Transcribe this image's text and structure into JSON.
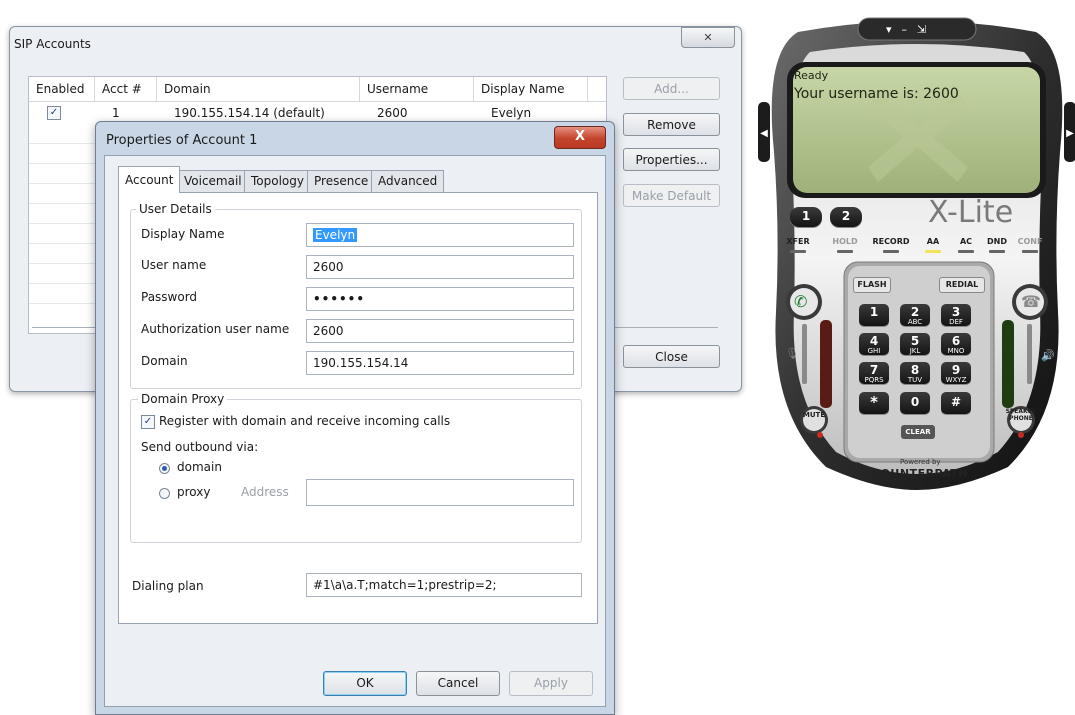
{
  "sip_window": {
    "title": "SIP Accounts",
    "close_glyph": "✕",
    "columns": [
      "Enabled",
      "Acct #",
      "Domain",
      "Username",
      "Display Name"
    ],
    "rows": [
      {
        "enabled": true,
        "acct": "1",
        "domain": "190.155.154.14 (default)",
        "username": "2600",
        "display_name": "Evelyn"
      }
    ],
    "buttons": {
      "add": "Add...",
      "remove": "Remove",
      "properties": "Properties...",
      "make_default": "Make Default",
      "close": "Close"
    }
  },
  "props_dialog": {
    "title": "Properties of Account 1",
    "close_glyph": "X",
    "tabs": [
      "Account",
      "Voicemail",
      "Topology",
      "Presence",
      "Advanced"
    ],
    "active_tab": "Account",
    "user_details": {
      "group_label": "User Details",
      "display_name_label": "Display Name",
      "display_name_value": "Evelyn",
      "user_name_label": "User name",
      "user_name_value": "2600",
      "password_label": "Password",
      "password_value": "••••••",
      "auth_user_label": "Authorization user name",
      "auth_user_value": "2600",
      "domain_label": "Domain",
      "domain_value": "190.155.154.14"
    },
    "domain_proxy": {
      "group_label": "Domain Proxy",
      "register_label": "Register with domain and receive incoming calls",
      "register_checked": true,
      "send_outbound_label": "Send outbound via:",
      "option_domain": "domain",
      "option_proxy": "proxy",
      "selected": "domain",
      "address_label": "Address",
      "address_value": ""
    },
    "dialing_plan_label": "Dialing plan",
    "dialing_plan_value": "#1\\a\\a.T;match=1;prestrip=2;",
    "buttons": {
      "ok": "OK",
      "cancel": "Cancel",
      "apply": "Apply"
    }
  },
  "phone": {
    "status_line": "Ready",
    "message": "Your username is: 2600",
    "brand": "X-Lite",
    "line_buttons": [
      "1",
      "2"
    ],
    "function_buttons": [
      "XFER",
      "HOLD",
      "RECORD",
      "AA",
      "AC",
      "DND",
      "CONF"
    ],
    "flash_label": "FLASH",
    "redial_label": "REDIAL",
    "keys": [
      {
        "main": "1",
        "sub": ""
      },
      {
        "main": "2",
        "sub": "ABC"
      },
      {
        "main": "3",
        "sub": "DEF"
      },
      {
        "main": "4",
        "sub": "GHI"
      },
      {
        "main": "5",
        "sub": "JKL"
      },
      {
        "main": "6",
        "sub": "MNO"
      },
      {
        "main": "7",
        "sub": "PQRS"
      },
      {
        "main": "8",
        "sub": "TUV"
      },
      {
        "main": "9",
        "sub": "WXYZ"
      },
      {
        "main": "*",
        "sub": ""
      },
      {
        "main": "0",
        "sub": ""
      },
      {
        "main": "#",
        "sub": ""
      }
    ],
    "mute_label": "MUTE",
    "clear_label": "CLEAR",
    "speaker_label": "SPEAKER PHONE",
    "powered_by": "Powered by",
    "vendor": "COUNTERPATH",
    "accent_color": "#f2e35a"
  }
}
